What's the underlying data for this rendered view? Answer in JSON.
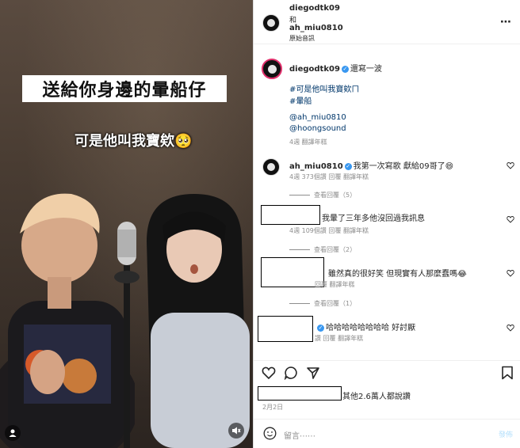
{
  "media": {
    "caption": "送給你身邊的暈船仔",
    "subcaption": "可是他叫我寶欸🥺"
  },
  "header": {
    "user1": "diegodtk09",
    "joiner": "和",
    "user2": "ah_miu0810",
    "audio": "原始音訊",
    "more": "⋯"
  },
  "post": {
    "username": "diegodtk09",
    "text": "還寫一波",
    "line1": "#可是他叫我寶欸ㄇ",
    "line2": "#暈船",
    "mention1": "@ah_miu0810",
    "mention2": "@hoongsound",
    "meta": "4週  翻譯年糕"
  },
  "comments": [
    {
      "username": "ah_miu0810",
      "text": "我第一次寫歌 獻給09哥了😄",
      "meta": "4週  373個讚  回覆  翻譯年糕",
      "replies": "查看回覆（5）"
    },
    {
      "text": "我暈了三年多他沒回過我訊息",
      "meta": "4週  109個讚  回覆  翻譯年糕",
      "replies": "查看回覆（2）"
    },
    {
      "text": "雖然真的很好笑 但現實有人那麼蠢嗎😂",
      "meta": "回覆  翻譯年糕",
      "replies": "查看回覆（1）"
    },
    {
      "text": "哈哈哈哈哈哈哈哈 好討厭",
      "meta": "讚  回覆  翻譯年糕"
    }
  ],
  "likes": {
    "text": "其他2.6萬人都說讚",
    "date": "2月2日"
  },
  "composer": {
    "placeholder": "留言⋯⋯",
    "post_label": "發佈"
  },
  "colors": {
    "link": "#00376b",
    "verified": "#3897f0",
    "muted": "#8e8e8e",
    "border": "#dbdbdb"
  }
}
